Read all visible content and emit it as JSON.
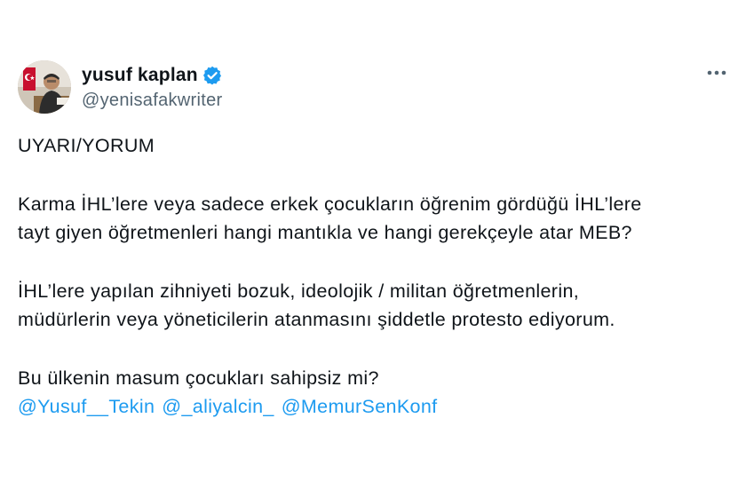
{
  "author": {
    "display_name": "yusuf kaplan",
    "handle": "@yenisafakwriter",
    "verified": true,
    "avatar_icon": "profile-photo"
  },
  "menu": {
    "more_icon": "more-options-icon"
  },
  "tweet": {
    "line1": "UYARI/YORUM",
    "line2": "Karma İHL’lere veya sadece erkek çocukların öğrenim gördüğü İHL’lere",
    "line3": "tayt giyen öğretmenleri hangi mantıkla ve hangi gerekçeyle atar MEB?",
    "line4": "İHL’lere yapılan zihniyeti bozuk, ideolojik / militan öğretmenlerin,",
    "line5": "müdürlerin veya yöneticilerin atanmasını şiddetle protesto ediyorum.",
    "line6": "Bu ülkenin masum çocukları sahipsiz mi?",
    "mentions": [
      "@Yusuf__Tekin",
      "@_aliyalcin_",
      "@MemurSenKonf"
    ]
  },
  "colors": {
    "link": "#1d9bf0",
    "secondary_text": "#536471",
    "primary_text": "#0f1419",
    "verified_badge": "#1d9bf0"
  }
}
